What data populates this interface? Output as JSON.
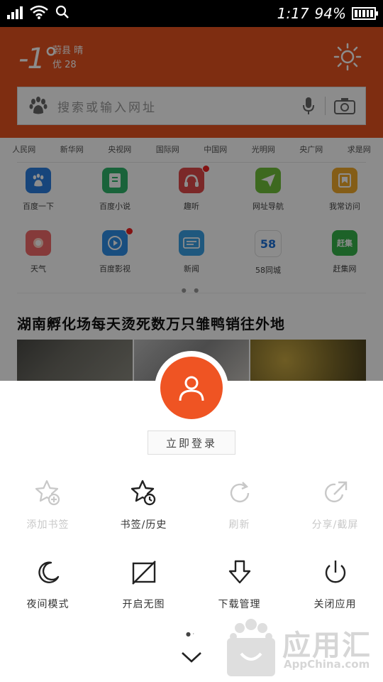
{
  "status_bar": {
    "time": "1:17",
    "battery_percent": "94%"
  },
  "header": {
    "temperature": "-1°",
    "location_weather": "蔚县 晴",
    "air_quality": "优 28",
    "brand_color": "#e6521f"
  },
  "search": {
    "placeholder": "搜索或输入网址"
  },
  "news_links": [
    "人民网",
    "新华网",
    "央视网",
    "国际网",
    "中国网",
    "光明网",
    "央广网",
    "求是网"
  ],
  "shortcuts": [
    {
      "label": "百度一下",
      "icon": "paw-icon",
      "color": "#2a7fe0",
      "badge": false
    },
    {
      "label": "百度小说",
      "icon": "book-icon",
      "color": "#2fb56a",
      "badge": false
    },
    {
      "label": "趣听",
      "icon": "headphones-icon",
      "color": "#e14a4a",
      "badge": true
    },
    {
      "label": "网址导航",
      "icon": "send-icon",
      "color": "#6fbf3a",
      "badge": false
    },
    {
      "label": "我常访问",
      "icon": "bookmark-icon",
      "color": "#f0a92a",
      "badge": false
    },
    {
      "label": "天气",
      "icon": "weather-icon",
      "color": "#f36b6b",
      "badge": false
    },
    {
      "label": "百度影视",
      "icon": "play-icon",
      "color": "#2f8fe8",
      "badge": true
    },
    {
      "label": "新闻",
      "icon": "news-icon",
      "color": "#3aa0e6",
      "badge": false
    },
    {
      "label": "58同城",
      "icon": "58-icon",
      "color": "#ffffff",
      "text": "58",
      "badge": false
    },
    {
      "label": "赶集网",
      "icon": "ganji-icon",
      "color": "#36b24a",
      "text": "赶集",
      "badge": false
    }
  ],
  "pager_dots": "● ●",
  "headline": "湖南孵化场每天烫死数万只雏鸭销往外地",
  "sheet": {
    "login_label": "立即登录",
    "row1": [
      {
        "label": "添加书签",
        "icon": "star-add-icon",
        "enabled": false
      },
      {
        "label": "书签/历史",
        "icon": "star-history-icon",
        "enabled": true
      },
      {
        "label": "刷新",
        "icon": "refresh-icon",
        "enabled": false
      },
      {
        "label": "分享/截屏",
        "icon": "share-icon",
        "enabled": false
      }
    ],
    "row2": [
      {
        "label": "夜间模式",
        "icon": "moon-icon",
        "enabled": true
      },
      {
        "label": "开启无图",
        "icon": "no-image-icon",
        "enabled": true
      },
      {
        "label": "下载管理",
        "icon": "download-icon",
        "enabled": true
      },
      {
        "label": "关闭应用",
        "icon": "power-icon",
        "enabled": true
      }
    ],
    "page_dots": "● ·"
  },
  "watermark": {
    "title": "应用汇",
    "subtitle": "AppChina.com"
  }
}
